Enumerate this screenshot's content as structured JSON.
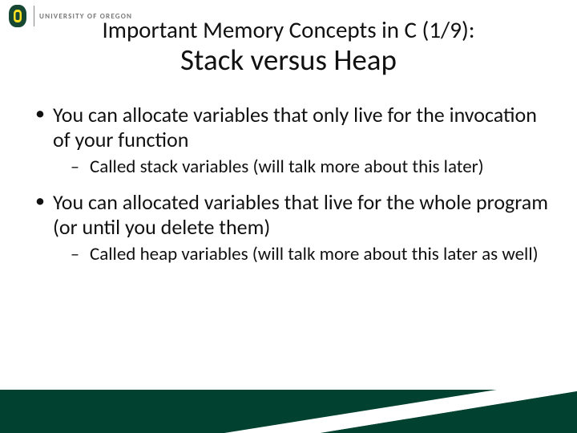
{
  "brand": {
    "name": "UNIVERSITY OF OREGON",
    "logo_fg": "#154733",
    "logo_accent": "#FEE123"
  },
  "title": {
    "line1": "Important Memory Concepts in C (1/9):",
    "line2": "Stack versus Heap"
  },
  "bullets": [
    {
      "text": "You can allocate variables that only live for the invocation of your function",
      "sub": [
        "Called stack variables (will talk more about this later)"
      ]
    },
    {
      "text": "You can allocated variables that live for the whole program (or until you delete them)",
      "sub": [
        "Called heap variables (will talk more about this later as well)"
      ]
    }
  ],
  "footer_color": "#00412f"
}
